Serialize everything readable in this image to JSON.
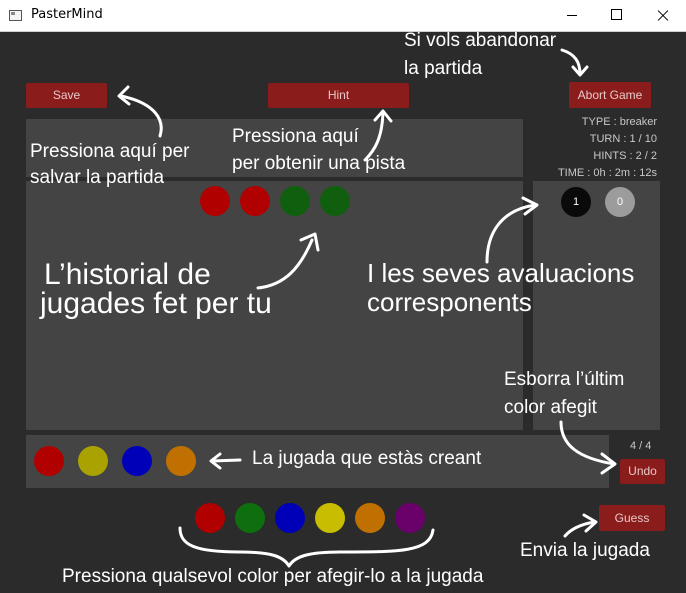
{
  "window": {
    "title": "PasterMind"
  },
  "buttons": {
    "save": "Save",
    "hint": "Hint",
    "abort": "Abort Game",
    "undo": "Undo",
    "guess": "Guess"
  },
  "info": {
    "type": "TYPE : breaker",
    "turn": "TURN : 1 / 10",
    "hints": "HINTS : 2 / 2",
    "time": "TIME : 0h : 2m : 12s"
  },
  "history": {
    "pegs": [
      "#b00000",
      "#b00000",
      "#0f5f0f",
      "#0f5f0f"
    ]
  },
  "evaluation": {
    "black": "1",
    "white": "0"
  },
  "current_guess": {
    "pegs": [
      "#b00000",
      "#aaa200",
      "#0000b8",
      "#c07000"
    ],
    "count": "4 / 4"
  },
  "palette": [
    "#b00000",
    "#0f6f0f",
    "#0000b8",
    "#c8bd00",
    "#c07000",
    "#6a006a"
  ],
  "annotations": {
    "abort_line1": "Si vols abandonar",
    "abort_line2": "la partida",
    "save_line1": "Pressiona aquí per",
    "save_line2": "salvar la partida",
    "hint_line1": "Pressiona aquí",
    "hint_line2": "per obtenir una pista",
    "history_line1": "L’historial de",
    "history_line2": "jugades fet per tu",
    "evals_line1": "I les seves avaluacions",
    "evals_line2": "corresponents",
    "undo_line1": "Esborra l’últim",
    "undo_line2": "color afegit",
    "current": "La jugada que estàs creant",
    "guess": "Envia la jugada",
    "palette": "Pressiona qualsevol color per afegir-lo a la jugada"
  }
}
